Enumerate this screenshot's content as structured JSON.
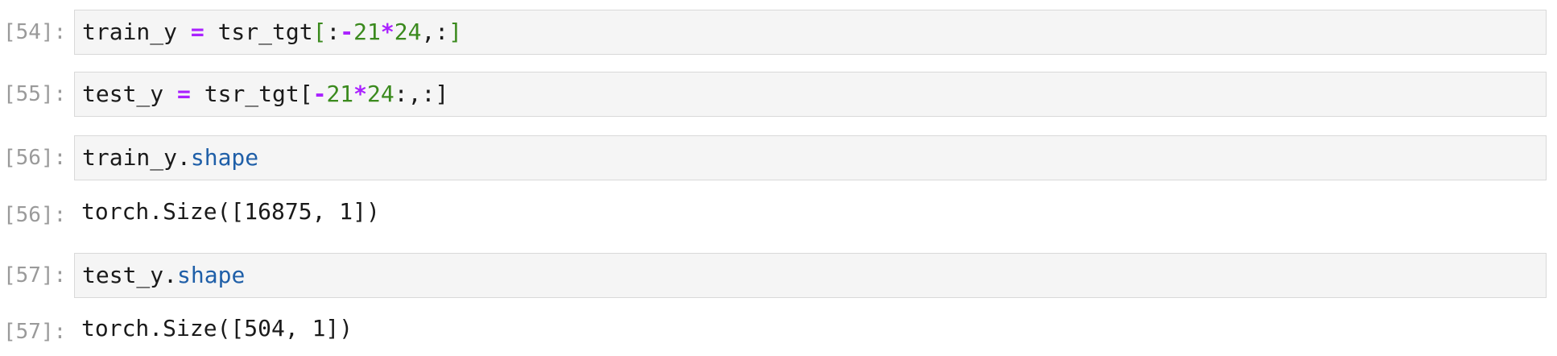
{
  "cells": [
    {
      "prompt": "[54]:",
      "type": "input",
      "tokens": [
        {
          "text": "train_y ",
          "cls": ""
        },
        {
          "text": "=",
          "cls": "op"
        },
        {
          "text": " tsr_tgt",
          "cls": ""
        },
        {
          "text": "[",
          "cls": "brk"
        },
        {
          "text": ":",
          "cls": ""
        },
        {
          "text": "-",
          "cls": "op"
        },
        {
          "text": "21",
          "cls": "num"
        },
        {
          "text": "*",
          "cls": "op"
        },
        {
          "text": "24",
          "cls": "num"
        },
        {
          "text": ",:",
          "cls": ""
        },
        {
          "text": "]",
          "cls": "brk"
        }
      ]
    },
    {
      "prompt": "[55]:",
      "type": "input",
      "tokens": [
        {
          "text": "test_y ",
          "cls": ""
        },
        {
          "text": "=",
          "cls": "op"
        },
        {
          "text": " tsr_tgt[",
          "cls": ""
        },
        {
          "text": "-",
          "cls": "op"
        },
        {
          "text": "21",
          "cls": "num"
        },
        {
          "text": "*",
          "cls": "op"
        },
        {
          "text": "24",
          "cls": "num"
        },
        {
          "text": ":,:]",
          "cls": ""
        }
      ]
    },
    {
      "prompt": "[56]:",
      "type": "input",
      "tokens": [
        {
          "text": "train_y.",
          "cls": ""
        },
        {
          "text": "shape",
          "cls": "attr"
        }
      ]
    },
    {
      "prompt": "[56]:",
      "type": "output",
      "text": "torch.Size([16875, 1])"
    },
    {
      "prompt": "[57]:",
      "type": "input",
      "tokens": [
        {
          "text": "test_y.",
          "cls": ""
        },
        {
          "text": "shape",
          "cls": "attr"
        }
      ]
    },
    {
      "prompt": "[57]:",
      "type": "output",
      "text": "torch.Size([504, 1])"
    }
  ]
}
